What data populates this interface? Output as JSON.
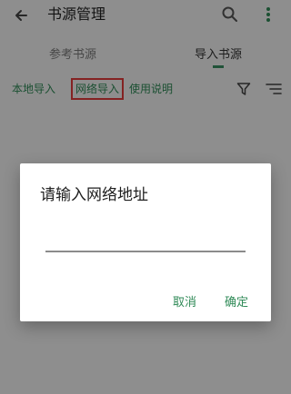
{
  "toolbar": {
    "title": "书源管理",
    "back_icon": "arrow-left-icon",
    "search_icon": "search-icon",
    "more_icon": "more-vert-icon"
  },
  "tabs": [
    {
      "label": "参考书源",
      "active": false
    },
    {
      "label": "导入书源",
      "active": true
    }
  ],
  "actions": {
    "local_import": "本地导入",
    "network_import": "网络导入",
    "usage_guide": "使用说明",
    "filter_icon": "filter-icon",
    "sort_icon": "sort-icon"
  },
  "dialog": {
    "title": "请输入网络地址",
    "input_value": "",
    "cancel_label": "取消",
    "ok_label": "确定"
  },
  "colors": {
    "accent": "#2f8a57",
    "highlight": "#e33b3b"
  }
}
